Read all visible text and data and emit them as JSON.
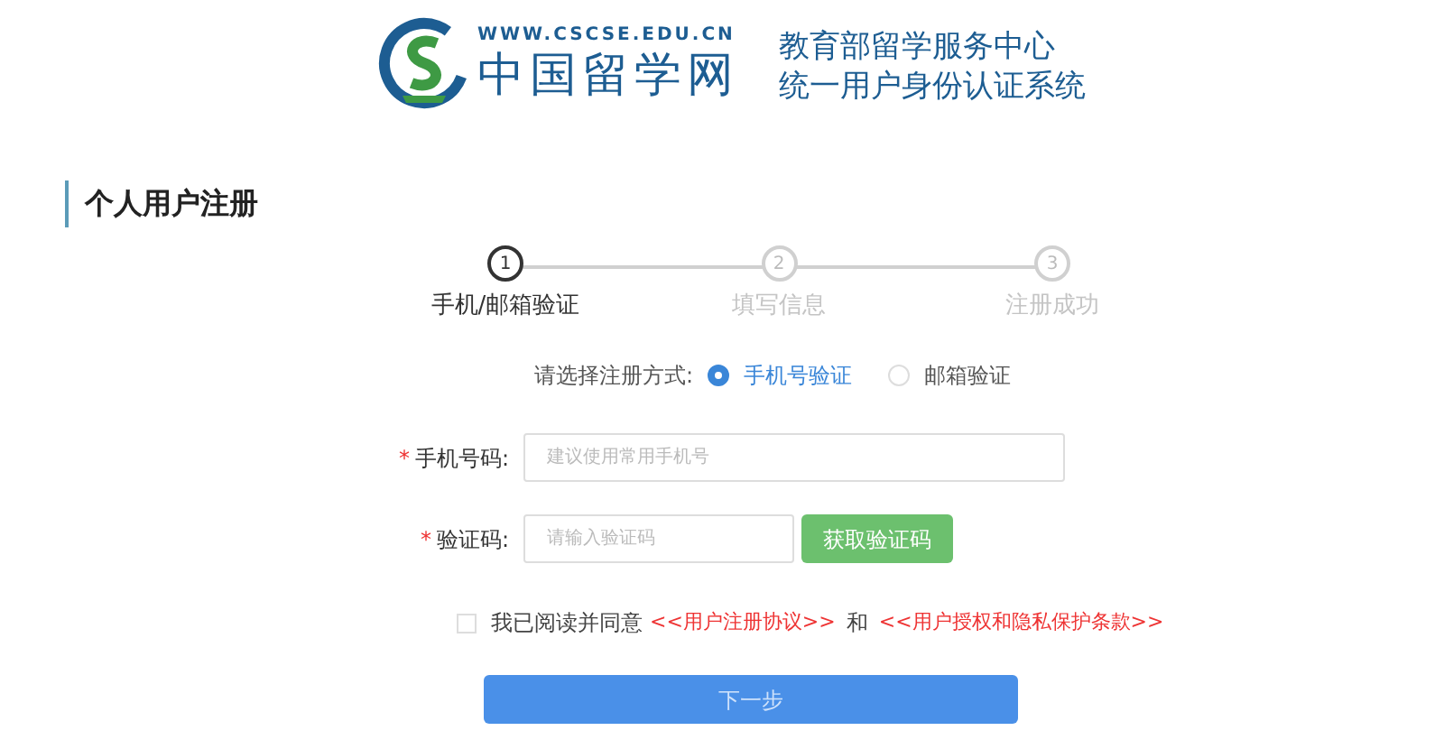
{
  "header": {
    "site_url": "WWW.CSCSE.EDU.CN",
    "site_name": "中国留学网",
    "title_lines": [
      "教育部留学服务中心",
      "统一用户身份认证系统"
    ]
  },
  "section_title": "个人用户注册",
  "steps": [
    {
      "number": "1",
      "label": "手机/邮箱验证",
      "selected": true
    },
    {
      "number": "2",
      "label": "填写信息",
      "selected": false
    },
    {
      "number": "3",
      "label": "注册成功",
      "selected": false
    }
  ],
  "method": {
    "label": "请选择注册方式:",
    "options": [
      {
        "label": "手机号验证",
        "selected": true
      },
      {
        "label": "邮箱验证",
        "selected": false
      }
    ]
  },
  "fields": [
    {
      "kind": "text",
      "label": "手机号码:",
      "required_mark": "*",
      "placeholder": "建议使用常用手机号"
    },
    {
      "kind": "code",
      "label": "验证码:",
      "required_mark": "*",
      "placeholder": "请输入验证码",
      "button": "获取验证码"
    }
  ],
  "agreement": {
    "checked": false,
    "text": "我已阅读并同意",
    "link_1": "<<用户注册协议>>",
    "conjunction": "和",
    "link_2": "<<用户授权和隐私保护条款>>"
  },
  "next_button": "下一步"
}
